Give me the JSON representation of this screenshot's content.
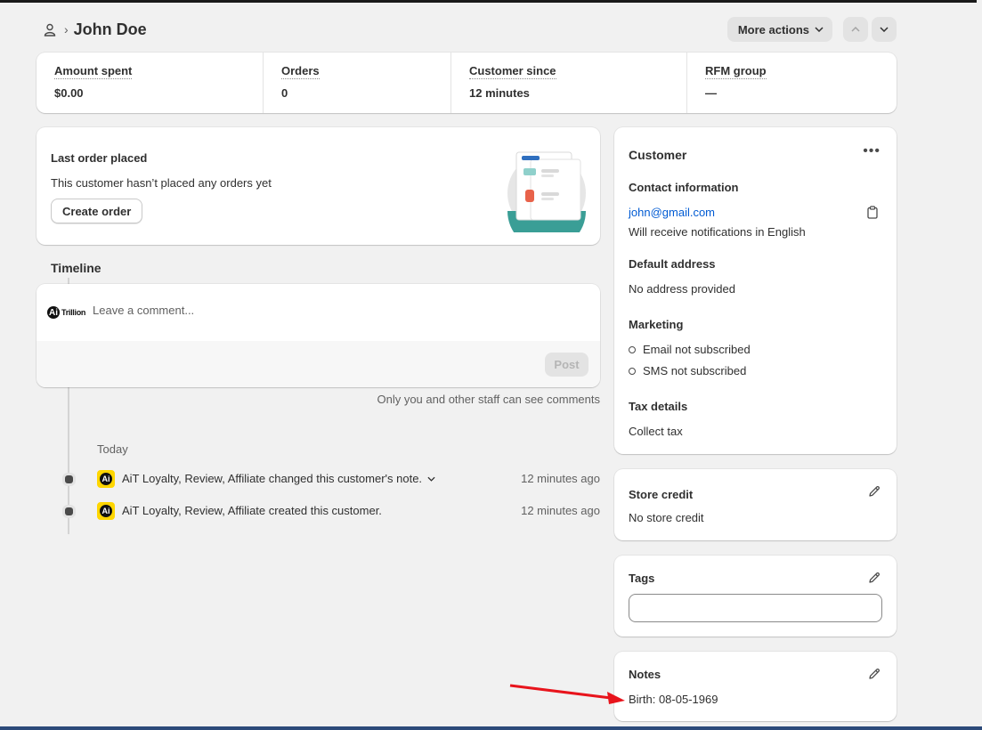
{
  "header": {
    "title": "John Doe",
    "more_actions_label": "More actions"
  },
  "stats": [
    {
      "label": "Amount spent",
      "value": "$0.00"
    },
    {
      "label": "Orders",
      "value": "0"
    },
    {
      "label": "Customer since",
      "value": "12 minutes"
    },
    {
      "label": "RFM group",
      "value": "—"
    }
  ],
  "last_order": {
    "title": "Last order placed",
    "description": "This customer hasn’t placed any orders yet",
    "create_order_label": "Create order"
  },
  "timeline": {
    "title": "Timeline",
    "comment_placeholder": "Leave a comment...",
    "post_label": "Post",
    "logo_ai": "Ai",
    "logo_text": "Trillion",
    "staff_note": "Only you and other staff can see comments",
    "date_group": "Today",
    "events": [
      {
        "text": "AiT Loyalty, Review, Affiliate changed this customer's note.",
        "time": "12 minutes ago",
        "expandable": true
      },
      {
        "text": "AiT Loyalty, Review, Affiliate created this customer.",
        "time": "12 minutes ago",
        "expandable": false
      }
    ],
    "app_badge": "Ai"
  },
  "customer": {
    "title": "Customer",
    "menu_glyph": "•••",
    "contact_heading": "Contact information",
    "email": "john@gmail.com",
    "notification_language": "Will receive notifications in English",
    "address_heading": "Default address",
    "address_value": "No address provided",
    "marketing_heading": "Marketing",
    "email_marketing": "Email not subscribed",
    "sms_marketing": "SMS not subscribed",
    "tax_heading": "Tax details",
    "tax_value": "Collect tax"
  },
  "store_credit": {
    "title": "Store credit",
    "value": "No store credit"
  },
  "tags": {
    "title": "Tags",
    "input_value": ""
  },
  "notes": {
    "title": "Notes",
    "value": "Birth: 08-05-1969"
  },
  "colors": {
    "background": "#f1f1f1",
    "card": "#ffffff",
    "link": "#005bd3",
    "annotation_arrow": "#e8141c",
    "app_badge": "#ffd600",
    "illustration_teal": "#3a9e96"
  },
  "icons": [
    "person-icon",
    "chevron-right-icon",
    "chevron-down-icon",
    "chevron-up-icon",
    "emoji-icon",
    "mention-icon",
    "hashtag-icon",
    "link-icon",
    "copy-icon",
    "pencil-icon",
    "more-horizontal-icon"
  ]
}
